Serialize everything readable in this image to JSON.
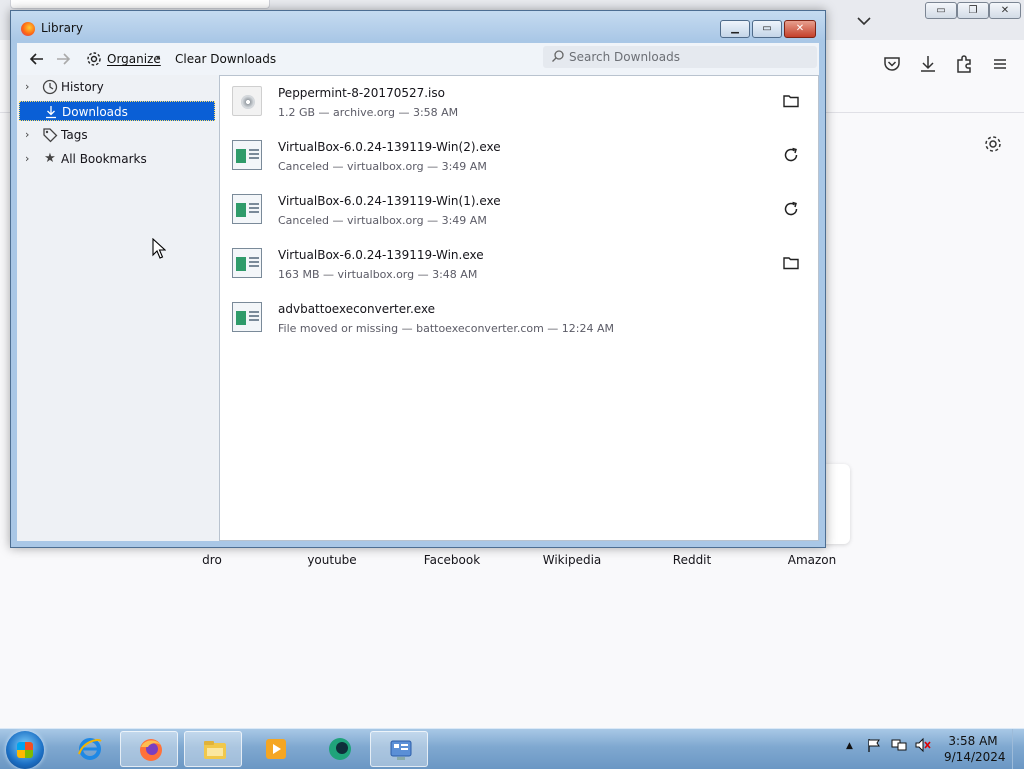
{
  "browser": {
    "shortcuts": [
      "dro",
      "youtube",
      "Facebook",
      "Wikipedia",
      "Reddit",
      "Amazon"
    ],
    "window_controls": {
      "minimize": "▭",
      "restore": "❐",
      "close": "✕"
    },
    "icons": {
      "list_all_tabs": "chevron-down-icon",
      "pocket": "pocket-icon",
      "downloads": "download-icon",
      "extensions": "extensions-icon",
      "menu": "menu-icon",
      "settings": "gear-icon"
    }
  },
  "library": {
    "title": "Library",
    "toolbar": {
      "organize_label": "Organize",
      "clear_label": "Clear Downloads",
      "search_placeholder": "Search Downloads"
    },
    "sidebar": [
      {
        "label": "History",
        "icon": "clock-icon",
        "selected": false,
        "expandable": true
      },
      {
        "label": "Downloads",
        "icon": "download-icon",
        "selected": true,
        "expandable": false
      },
      {
        "label": "Tags",
        "icon": "tag-icon",
        "selected": false,
        "expandable": true
      },
      {
        "label": "All Bookmarks",
        "icon": "star-icon",
        "selected": false,
        "expandable": true
      }
    ],
    "downloads": [
      {
        "name": "Peppermint-8-20170527.iso",
        "status": "1.2 GB — archive.org — 3:58 AM",
        "file_icon": "disc-image-icon",
        "action_icon": "folder-icon"
      },
      {
        "name": "VirtualBox-6.0.24-139119-Win(2).exe",
        "status": "Canceled — virtualbox.org — 3:49 AM",
        "file_icon": "exe-icon",
        "action_icon": "retry-icon"
      },
      {
        "name": "VirtualBox-6.0.24-139119-Win(1).exe",
        "status": "Canceled — virtualbox.org — 3:49 AM",
        "file_icon": "exe-icon",
        "action_icon": "retry-icon"
      },
      {
        "name": "VirtualBox-6.0.24-139119-Win.exe",
        "status": "163 MB — virtualbox.org — 3:48 AM",
        "file_icon": "exe-icon",
        "action_icon": "folder-icon"
      },
      {
        "name": "advbattoexeconverter.exe",
        "status": "File moved or missing — battoexeconverter.com — 12:24 AM",
        "file_icon": "exe-icon",
        "action_icon": ""
      }
    ]
  },
  "taskbar": {
    "apps": [
      "internet-explorer-icon",
      "firefox-icon",
      "file-explorer-icon",
      "media-player-icon",
      "app-icon",
      "control-panel-icon"
    ],
    "clock_time": "3:58 AM",
    "clock_date": "9/14/2024"
  }
}
